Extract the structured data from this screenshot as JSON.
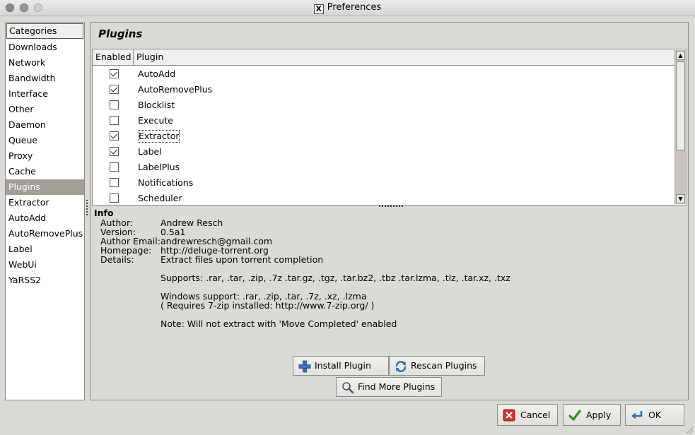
{
  "window": {
    "title": "Preferences"
  },
  "categories": {
    "header": "Categories",
    "items": [
      "Downloads",
      "Network",
      "Bandwidth",
      "Interface",
      "Other",
      "Daemon",
      "Queue",
      "Proxy",
      "Cache",
      "Plugins",
      "Extractor",
      "AutoAdd",
      "AutoRemovePlus",
      "Label",
      "WebUi",
      "YaRSS2"
    ],
    "selected": "Plugins"
  },
  "panel": {
    "title": "Plugins",
    "columns": {
      "enabled": "Enabled",
      "plugin": "Plugin"
    },
    "plugins": [
      {
        "name": "AutoAdd",
        "enabled": true
      },
      {
        "name": "AutoRemovePlus",
        "enabled": true
      },
      {
        "name": "Blocklist",
        "enabled": false
      },
      {
        "name": "Execute",
        "enabled": false
      },
      {
        "name": "Extractor",
        "enabled": true
      },
      {
        "name": "Label",
        "enabled": true
      },
      {
        "name": "LabelPlus",
        "enabled": false
      },
      {
        "name": "Notifications",
        "enabled": false
      },
      {
        "name": "Scheduler",
        "enabled": false
      }
    ],
    "focused_plugin": "Extractor"
  },
  "info": {
    "heading": "Info",
    "author_label": "Author:",
    "author": "Andrew Resch",
    "version_label": "Version:",
    "version": "0.5a1",
    "email_label": "Author Email:",
    "email": "andrewresch@gmail.com",
    "homepage_label": "Homepage:",
    "homepage": "http://deluge-torrent.org",
    "details_label": "Details:",
    "details_1": "Extract files upon torrent completion",
    "details_2": "Supports: .rar, .tar, .zip, .7z .tar.gz, .tgz, .tar.bz2, .tbz .tar.lzma, .tlz, .tar.xz, .txz",
    "details_3": "Windows support: .rar, .zip, .tar, .7z, .xz, .lzma",
    "details_4": "( Requires 7-zip installed: http://www.7-zip.org/ )",
    "details_5": "Note: Will not extract with 'Move Completed' enabled"
  },
  "buttons": {
    "install_plugin": "Install Plugin",
    "rescan_plugins": "Rescan Plugins",
    "find_more_plugins": "Find More Plugins",
    "cancel": "Cancel",
    "apply": "Apply",
    "ok": "OK"
  },
  "colors": {
    "selection": "#a39f98",
    "window_bg": "#dcdad5"
  }
}
